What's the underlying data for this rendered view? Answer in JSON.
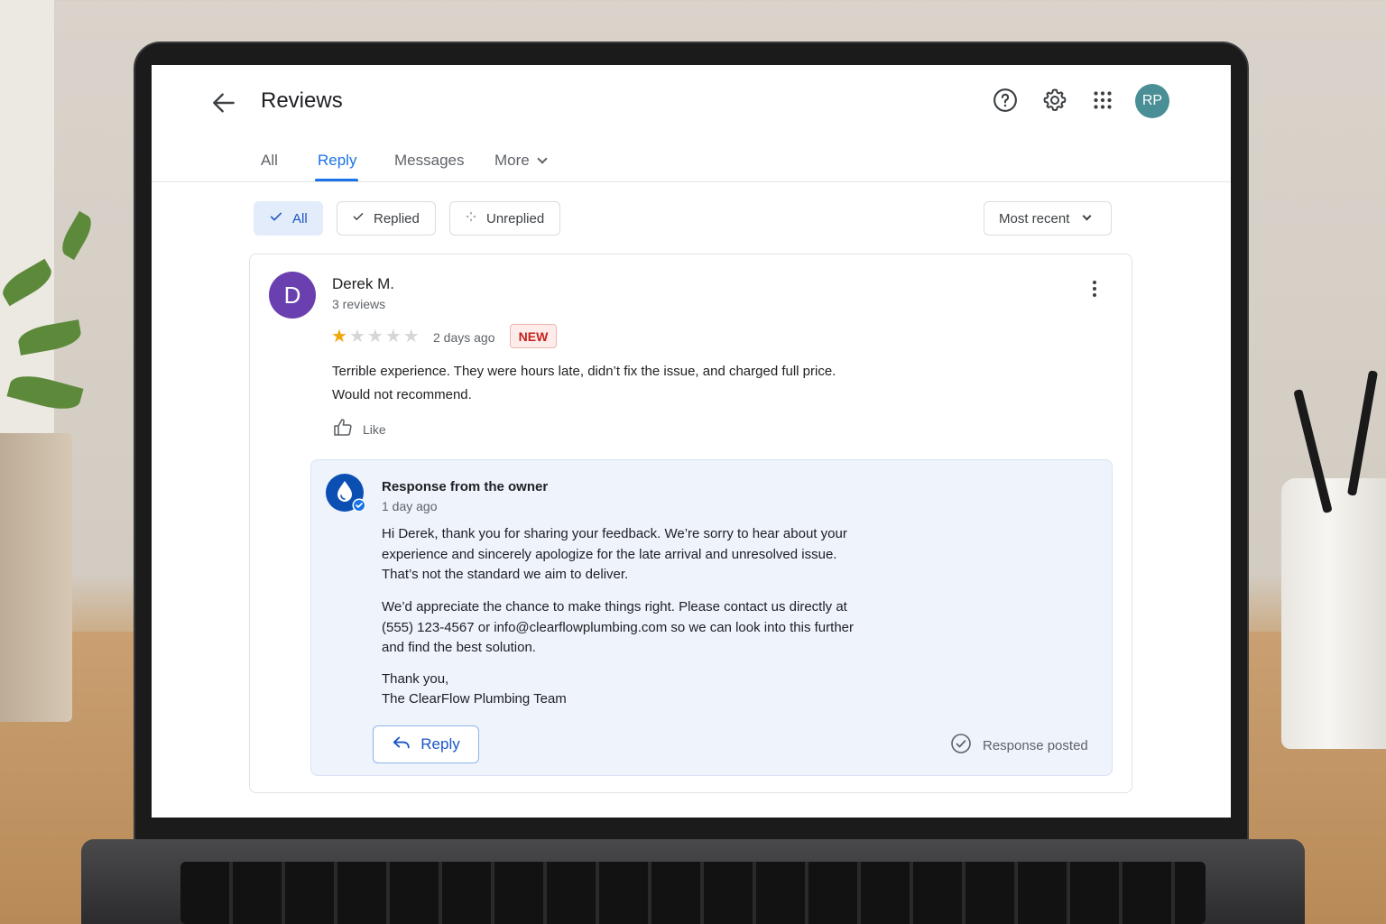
{
  "header": {
    "title": "Reviews",
    "avatar_initials": "RP"
  },
  "tabs": [
    {
      "label": "All"
    },
    {
      "label": "Reply"
    },
    {
      "label": "Messages"
    },
    {
      "label": "More"
    }
  ],
  "filters": {
    "chips": [
      {
        "label": "All",
        "selected": true
      },
      {
        "label": "Replied",
        "selected": false
      },
      {
        "label": "Unreplied",
        "selected": false
      }
    ],
    "sort_label": "Most recent"
  },
  "review": {
    "avatar_initial": "D",
    "author": "Derek M.",
    "review_count": "3 reviews",
    "rating": 1,
    "max_rating": 5,
    "time": "2 days ago",
    "badge": "NEW",
    "text_line1": "Terrible experience. They were hours late, didn’t fix the issue, and charged full price.",
    "text_line2": "Would not recommend.",
    "like_label": "Like"
  },
  "owner_response": {
    "title": "Response from the owner",
    "time": "1 day ago",
    "para1_l1": "Hi Derek, thank you for sharing your feedback. We’re sorry to hear about your",
    "para1_l2": "experience and sincerely apologize for the late arrival and unresolved issue.",
    "para1_l3": "That’s not the standard we aim to deliver.",
    "para2_l1": "We’d appreciate the chance to make things right. Please contact us directly at",
    "para2_l2": "(555) 123-4567 or info@clearflowplumbing.com so we can look into this further",
    "para2_l3": "and find the best solution.",
    "signoff_l1": "Thank you,",
    "signoff_l2": "The ClearFlow Plumbing Team",
    "reply_label": "Reply",
    "status": "Response posted"
  },
  "colors": {
    "accent": "#1a73e8",
    "star": "#f2a60c",
    "avatar_rp": "#4a8e96",
    "avatar_d": "#6a3fb0",
    "badge_red": "#c5221f"
  },
  "icons": [
    "back-arrow-icon",
    "help-icon",
    "gear-icon",
    "apps-grid-icon",
    "check-icon",
    "sparkle-icon",
    "chevron-down-icon",
    "more-vert-icon",
    "thumb-up-icon",
    "water-drop-icon",
    "verified-badge-icon",
    "reply-arrow-icon",
    "check-circle-icon"
  ]
}
